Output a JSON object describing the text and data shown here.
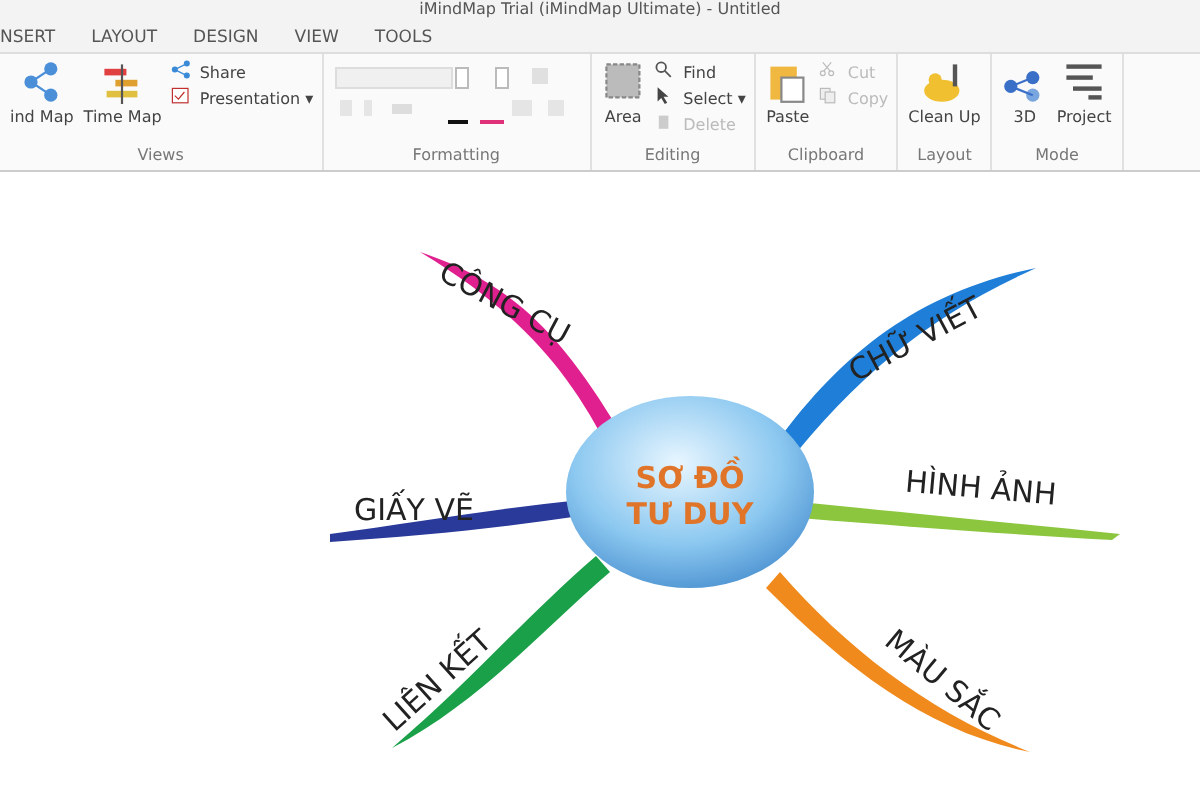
{
  "window": {
    "title": "iMindMap Trial (iMindMap Ultimate) - Untitled"
  },
  "tabs": [
    {
      "label": "NSERT",
      "selected": false
    },
    {
      "label": "LAYOUT",
      "selected": false
    },
    {
      "label": "DESIGN",
      "selected": false
    },
    {
      "label": "VIEW",
      "selected": false
    },
    {
      "label": "TOOLS",
      "selected": false
    }
  ],
  "ribbon": [
    {
      "label": "Views",
      "items": [
        {
          "kind": "large",
          "label": "ind Map",
          "disabled": false
        },
        {
          "kind": "large",
          "label": "Time Map",
          "disabled": false
        },
        {
          "kind": "stack",
          "items": [
            {
              "label": "Share",
              "disabled": false
            },
            {
              "label": "Presentation ▾",
              "disabled": false
            }
          ]
        }
      ]
    },
    {
      "label": "Formatting",
      "items": [
        {
          "kind": "format"
        }
      ]
    },
    {
      "label": "Editing",
      "items": [
        {
          "kind": "large",
          "label": "Area",
          "disabled": false
        },
        {
          "kind": "stack",
          "items": [
            {
              "label": "Find",
              "disabled": false
            },
            {
              "label": "Select ▾",
              "disabled": false
            },
            {
              "label": "Delete",
              "disabled": true
            }
          ]
        }
      ]
    },
    {
      "label": "Clipboard",
      "items": [
        {
          "kind": "large",
          "label": "Paste",
          "disabled": false
        },
        {
          "kind": "stack",
          "items": [
            {
              "label": "Cut",
              "disabled": true
            },
            {
              "label": "Copy",
              "disabled": true
            }
          ]
        }
      ]
    },
    {
      "label": "Layout",
      "items": [
        {
          "kind": "large",
          "label": "Clean Up",
          "disabled": false
        }
      ]
    },
    {
      "label": "Mode",
      "items": [
        {
          "kind": "large",
          "label": "3D",
          "disabled": false
        },
        {
          "kind": "large",
          "label": "Project",
          "disabled": false
        }
      ]
    }
  ],
  "mind_map": {
    "central": {
      "lines": [
        "SƠ ĐỒ",
        "TƯ DUY"
      ]
    },
    "branches": [
      {
        "label": "CÔNG CỤ",
        "color": "#e0208f"
      },
      {
        "label": "CHỮ VIẾT",
        "color": "#1f7fd8"
      },
      {
        "label": "GIẤY VẼ",
        "color": "#2a3a9a"
      },
      {
        "label": "HÌNH ẢNH",
        "color": "#8cc63f"
      },
      {
        "label": "LIÊN KẾT",
        "color": "#1aa048"
      },
      {
        "label": "MÀU SẮC",
        "color": "#f08a1c"
      }
    ]
  }
}
